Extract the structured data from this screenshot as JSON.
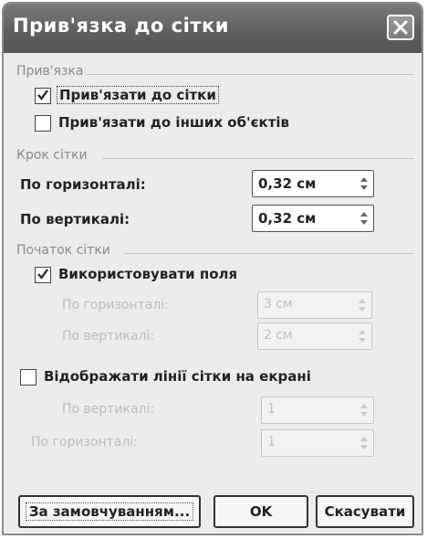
{
  "dialog": {
    "title": "Прив'язка до сітки",
    "close_icon": "close-x-icon"
  },
  "snap": {
    "group_label": "Прив'язка",
    "snap_to_grid": {
      "label": "Прив'язати до сітки",
      "checked": true
    },
    "snap_to_objects": {
      "label": "Прив'язати до інших об'єктів",
      "checked": false
    }
  },
  "spacing": {
    "group_label": "Крок сітки",
    "horizontal": {
      "label": "По горизонталі:",
      "value": "0,32 см"
    },
    "vertical": {
      "label": "По вертикалі:",
      "value": "0,32 см"
    }
  },
  "origin": {
    "group_label": "Початок сітки",
    "use_margins": {
      "label": "Використовувати поля",
      "checked": true
    },
    "horizontal": {
      "label": "По горизонталі:",
      "value": "3 см"
    },
    "vertical": {
      "label": "По вертикалі:",
      "value": "2 см"
    }
  },
  "display": {
    "show_gridlines": {
      "label": "Відображати лінії сітки на екрані",
      "checked": false
    },
    "vertical_every": {
      "label": "По вертикалі:",
      "value": "1"
    },
    "horizontal_every": {
      "label": "По горизонталі:",
      "value": "1"
    }
  },
  "buttons": {
    "default": "За замовчуванням...",
    "ok": "OK",
    "cancel": "Скасувати"
  }
}
